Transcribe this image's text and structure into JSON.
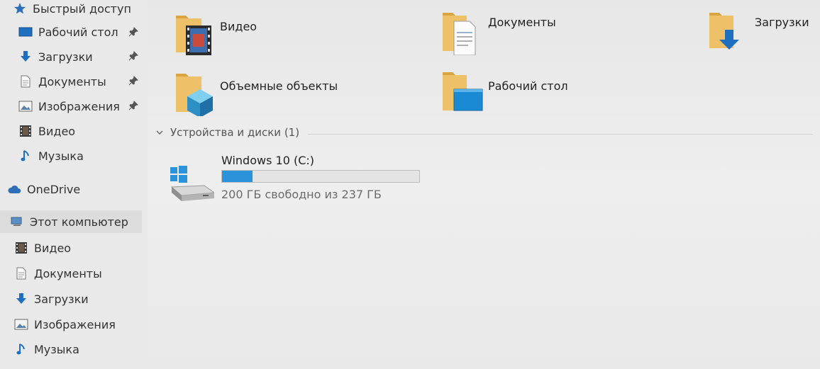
{
  "sidebar": {
    "quick_access": "Быстрый доступ",
    "pinned": [
      {
        "label": "Рабочий стол",
        "icon": "desktop-icon"
      },
      {
        "label": "Загрузки",
        "icon": "downloads-icon"
      },
      {
        "label": "Документы",
        "icon": "documents-icon"
      },
      {
        "label": "Изображения",
        "icon": "pictures-icon"
      }
    ],
    "quick_unpinned": [
      {
        "label": "Видео",
        "icon": "video-icon"
      },
      {
        "label": "Музыка",
        "icon": "music-icon"
      }
    ],
    "onedrive": "OneDrive",
    "this_pc": "Этот компьютер",
    "this_pc_children": [
      {
        "label": "Видео",
        "icon": "video-icon"
      },
      {
        "label": "Документы",
        "icon": "documents-icon"
      },
      {
        "label": "Загрузки",
        "icon": "downloads-icon"
      },
      {
        "label": "Изображения",
        "icon": "pictures-icon"
      },
      {
        "label": "Музыка",
        "icon": "music-icon"
      }
    ]
  },
  "folders": [
    {
      "label": "Видео",
      "icon": "video-folder-icon"
    },
    {
      "label": "Документы",
      "icon": "documents-folder-icon"
    },
    {
      "label": "Загрузки",
      "icon": "downloads-folder-icon"
    },
    {
      "label": "Объемные объекты",
      "icon": "3d-objects-folder-icon"
    },
    {
      "label": "Рабочий стол",
      "icon": "desktop-folder-icon"
    }
  ],
  "devices": {
    "header": "Устройства и диски (1)",
    "drive": {
      "name": "Windows 10 (C:)",
      "free_text": "200 ГБ свободно из 237 ГБ",
      "used_fraction": 0.156
    }
  },
  "colors": {
    "accent": "#2b93d9",
    "folder": "#e9c46a",
    "selected_bg": "#dcdcdc"
  }
}
